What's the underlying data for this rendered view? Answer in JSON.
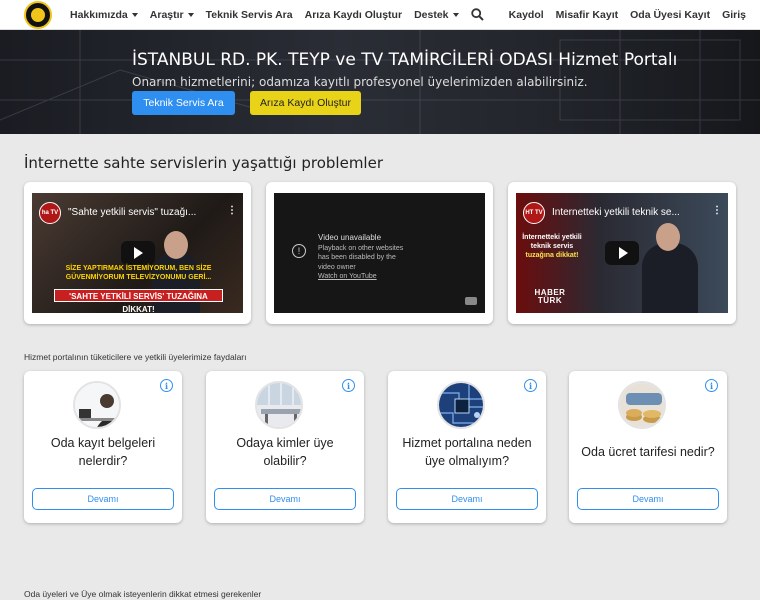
{
  "navbar": {
    "logo": "chamber-logo",
    "left_items": [
      {
        "label": "Hakkımızda",
        "dropdown": true
      },
      {
        "label": "Araştır",
        "dropdown": true
      },
      {
        "label": "Teknik Servis Ara",
        "dropdown": false
      },
      {
        "label": "Arıza Kaydı Oluştur",
        "dropdown": false
      },
      {
        "label": "Destek",
        "dropdown": true
      }
    ],
    "search_icon": "search-icon",
    "right_items": [
      "Kaydol",
      "Misafir Kayıt",
      "Oda Üyesi Kayıt",
      "Giriş"
    ]
  },
  "hero": {
    "title": "İSTANBUL RD. PK. TEYP ve TV TAMİRCİLERİ ODASI Hizmet Portalı",
    "subtitle": "Onarım hizmetlerini; odamıza kayıtlı profesyonel üyelerimizden alabilirsiniz.",
    "primary_button": "Teknik Servis Ara",
    "secondary_button": "Arıza Kaydı Oluştur",
    "colors": {
      "primary": "#2f8ff0",
      "secondary": "#e9d318"
    }
  },
  "videos_section": {
    "title": "İnternette sahte servislerin yaşattığı problemler",
    "videos": [
      {
        "title": "\"Sahte yetkili servis\" tuzağı...",
        "channel": "ha TV",
        "caption": "SİZE YAPTIRMAK İSTEMİYORUM, BEN SİZE GÜVENMİYORUM TELEVİZYONUMU GERİ...",
        "banner": "'SAHTE YETKİLİ SERVİS' TUZAĞINA DİKKAT!"
      },
      {
        "unavailable_title": "Video unavailable",
        "unavailable_text": "Playback on other websites has been disabled by the video owner",
        "link": "Watch on YouTube"
      },
      {
        "title": "İnternetteki yetkili teknik se...",
        "channel": "HT TV",
        "left_text": "İnternetteki yetkili teknik servis",
        "left_highlight": "tuzağına dikkat!",
        "logo_text": "HABER TÜRK"
      }
    ]
  },
  "benefits_section": {
    "title": "Hizmet portalının tüketicilere ve yetkili üyelerimize faydaları",
    "cards": [
      {
        "title": "Oda kayıt belgeleri nelerdir?",
        "button": "Devamı",
        "image": "call-center-image"
      },
      {
        "title": "Odaya kimler üye olabilir?",
        "button": "Devamı",
        "image": "office-image"
      },
      {
        "title": "Hizmet portalına neden üye olmalıyım?",
        "button": "Devamı",
        "image": "circuit-board-image"
      },
      {
        "title": "Oda ücret tarifesi nedir?",
        "button": "Devamı",
        "image": "coins-image"
      }
    ]
  },
  "members_section": {
    "title": "Oda üyeleri ve Üye olmak isteyenlerin dikkat etmesi gerekenler"
  }
}
